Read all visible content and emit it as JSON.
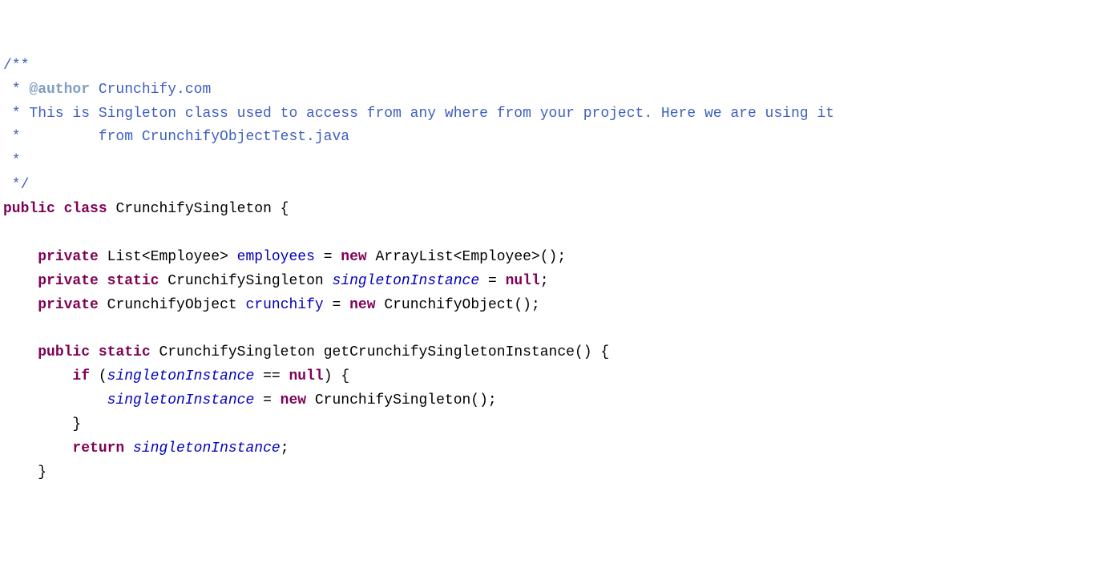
{
  "tokens": [
    {
      "cls": "jdoc-text",
      "t": "/**"
    },
    {
      "cls": "",
      "t": "\n"
    },
    {
      "cls": "jdoc-text",
      "t": " * "
    },
    {
      "cls": "jdoc-tag",
      "t": "@author"
    },
    {
      "cls": "jdoc-text",
      "t": " Crunchify.com"
    },
    {
      "cls": "",
      "t": "\n"
    },
    {
      "cls": "jdoc-text",
      "t": " * This is Singleton class used to access from any where from your project. Here we are using it"
    },
    {
      "cls": "",
      "t": "\n"
    },
    {
      "cls": "jdoc-text",
      "t": " *         from CrunchifyObjectTest.java"
    },
    {
      "cls": "",
      "t": "\n"
    },
    {
      "cls": "jdoc-text",
      "t": " * "
    },
    {
      "cls": "",
      "t": "\n"
    },
    {
      "cls": "jdoc-text",
      "t": " */"
    },
    {
      "cls": "",
      "t": "\n"
    },
    {
      "cls": "keyword",
      "t": "public"
    },
    {
      "cls": "plain",
      "t": " "
    },
    {
      "cls": "keyword",
      "t": "class"
    },
    {
      "cls": "plain",
      "t": " CrunchifySingleton {"
    },
    {
      "cls": "",
      "t": "\n"
    },
    {
      "cls": "",
      "t": "\n"
    },
    {
      "cls": "plain",
      "t": "    "
    },
    {
      "cls": "keyword",
      "t": "private"
    },
    {
      "cls": "plain",
      "t": " List<Employee> "
    },
    {
      "cls": "field",
      "t": "employees"
    },
    {
      "cls": "plain",
      "t": " = "
    },
    {
      "cls": "keyword",
      "t": "new"
    },
    {
      "cls": "plain",
      "t": " ArrayList<Employee>();"
    },
    {
      "cls": "",
      "t": "\n"
    },
    {
      "cls": "plain",
      "t": "    "
    },
    {
      "cls": "keyword",
      "t": "private"
    },
    {
      "cls": "plain",
      "t": " "
    },
    {
      "cls": "keyword",
      "t": "static"
    },
    {
      "cls": "plain",
      "t": " CrunchifySingleton "
    },
    {
      "cls": "static-field",
      "t": "singletonInstance"
    },
    {
      "cls": "plain",
      "t": " = "
    },
    {
      "cls": "keyword",
      "t": "null"
    },
    {
      "cls": "plain",
      "t": ";"
    },
    {
      "cls": "",
      "t": "\n"
    },
    {
      "cls": "plain",
      "t": "    "
    },
    {
      "cls": "keyword",
      "t": "private"
    },
    {
      "cls": "plain",
      "t": " CrunchifyObject "
    },
    {
      "cls": "field",
      "t": "crunchify"
    },
    {
      "cls": "plain",
      "t": " = "
    },
    {
      "cls": "keyword",
      "t": "new"
    },
    {
      "cls": "plain",
      "t": " CrunchifyObject();"
    },
    {
      "cls": "",
      "t": "\n"
    },
    {
      "cls": "",
      "t": "\n"
    },
    {
      "cls": "plain",
      "t": "    "
    },
    {
      "cls": "keyword",
      "t": "public"
    },
    {
      "cls": "plain",
      "t": " "
    },
    {
      "cls": "keyword",
      "t": "static"
    },
    {
      "cls": "plain",
      "t": " CrunchifySingleton getCrunchifySingletonInstance() {"
    },
    {
      "cls": "",
      "t": "\n"
    },
    {
      "cls": "plain",
      "t": "        "
    },
    {
      "cls": "keyword",
      "t": "if"
    },
    {
      "cls": "plain",
      "t": " ("
    },
    {
      "cls": "static-field",
      "t": "singletonInstance"
    },
    {
      "cls": "plain",
      "t": " == "
    },
    {
      "cls": "keyword",
      "t": "null"
    },
    {
      "cls": "plain",
      "t": ") {"
    },
    {
      "cls": "",
      "t": "\n"
    },
    {
      "cls": "plain",
      "t": "            "
    },
    {
      "cls": "static-field",
      "t": "singletonInstance"
    },
    {
      "cls": "plain",
      "t": " = "
    },
    {
      "cls": "keyword",
      "t": "new"
    },
    {
      "cls": "plain",
      "t": " CrunchifySingleton();"
    },
    {
      "cls": "",
      "t": "\n"
    },
    {
      "cls": "plain",
      "t": "        }"
    },
    {
      "cls": "",
      "t": "\n"
    },
    {
      "cls": "plain",
      "t": "        "
    },
    {
      "cls": "keyword",
      "t": "return"
    },
    {
      "cls": "plain",
      "t": " "
    },
    {
      "cls": "static-field",
      "t": "singletonInstance"
    },
    {
      "cls": "plain",
      "t": ";"
    },
    {
      "cls": "",
      "t": "\n"
    },
    {
      "cls": "plain",
      "t": "    }"
    }
  ]
}
